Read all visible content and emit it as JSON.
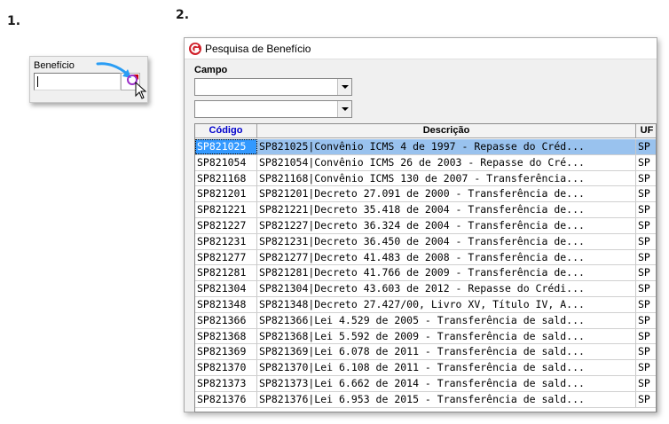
{
  "steps": {
    "one": "1.",
    "two": "2."
  },
  "panel1": {
    "field_label": "Benefício",
    "field_value": ""
  },
  "window": {
    "title": "Pesquisa de Benefício",
    "campo_label": "Campo",
    "combo1_value": "",
    "combo2_value": "",
    "columns": {
      "code": "Código",
      "desc": "Descrição",
      "uf": "UF"
    },
    "rows": [
      {
        "code": "SP821025",
        "desc": "SP821025|Convênio ICMS 4 de 1997 - Repasse do Créd...",
        "uf": "SP"
      },
      {
        "code": "SP821054",
        "desc": "SP821054|Convênio ICMS 26 de 2003 - Repasse do Cré...",
        "uf": "SP"
      },
      {
        "code": "SP821168",
        "desc": "SP821168|Convênio ICMS 130 de 2007 - Transferência...",
        "uf": "SP"
      },
      {
        "code": "SP821201",
        "desc": "SP821201|Decreto 27.091 de 2000 - Transferência de...",
        "uf": "SP"
      },
      {
        "code": "SP821221",
        "desc": "SP821221|Decreto 35.418 de 2004 - Transferência de...",
        "uf": "SP"
      },
      {
        "code": "SP821227",
        "desc": "SP821227|Decreto 36.324 de 2004 - Transferência de...",
        "uf": "SP"
      },
      {
        "code": "SP821231",
        "desc": "SP821231|Decreto 36.450 de 2004 - Transferência de...",
        "uf": "SP"
      },
      {
        "code": "SP821277",
        "desc": "SP821277|Decreto 41.483 de 2008 - Transferência de...",
        "uf": "SP"
      },
      {
        "code": "SP821281",
        "desc": "SP821281|Decreto 41.766 de 2009 - Transferência de...",
        "uf": "SP"
      },
      {
        "code": "SP821304",
        "desc": "SP821304|Decreto 43.603 de 2012 - Repasse do Crédi...",
        "uf": "SP"
      },
      {
        "code": "SP821348",
        "desc": "SP821348|Decreto 27.427/00, Livro XV, Título IV, A...",
        "uf": "SP"
      },
      {
        "code": "SP821366",
        "desc": "SP821366|Lei 4.529 de 2005 - Transferência de sald...",
        "uf": "SP"
      },
      {
        "code": "SP821368",
        "desc": "SP821368|Lei 5.592 de 2009 - Transferência de sald...",
        "uf": "SP"
      },
      {
        "code": "SP821369",
        "desc": "SP821369|Lei 6.078 de 2011 - Transferência de sald...",
        "uf": "SP"
      },
      {
        "code": "SP821370",
        "desc": "SP821370|Lei 6.108 de 2011 - Transferência de sald...",
        "uf": "SP"
      },
      {
        "code": "SP821373",
        "desc": "SP821373|Lei 6.662 de 2014 - Transferência de sald...",
        "uf": "SP"
      },
      {
        "code": "SP821376",
        "desc": "SP821376|Lei 6.953 de 2015 - Transferência de sald...",
        "uf": "SP"
      }
    ]
  },
  "colors": {
    "selected_code": "#3399ff",
    "selected_row": "#99c2ee",
    "header_code": "#0000cc",
    "logo": "#d0202a",
    "pointer_arrow": "#2a9df4",
    "magnifier": "#9b30c8"
  },
  "icons": {
    "logo": "g-logo-icon",
    "magnifier": "magnifier-icon",
    "cursor": "mouse-cursor-icon",
    "arrow": "pointer-arrow-icon"
  }
}
